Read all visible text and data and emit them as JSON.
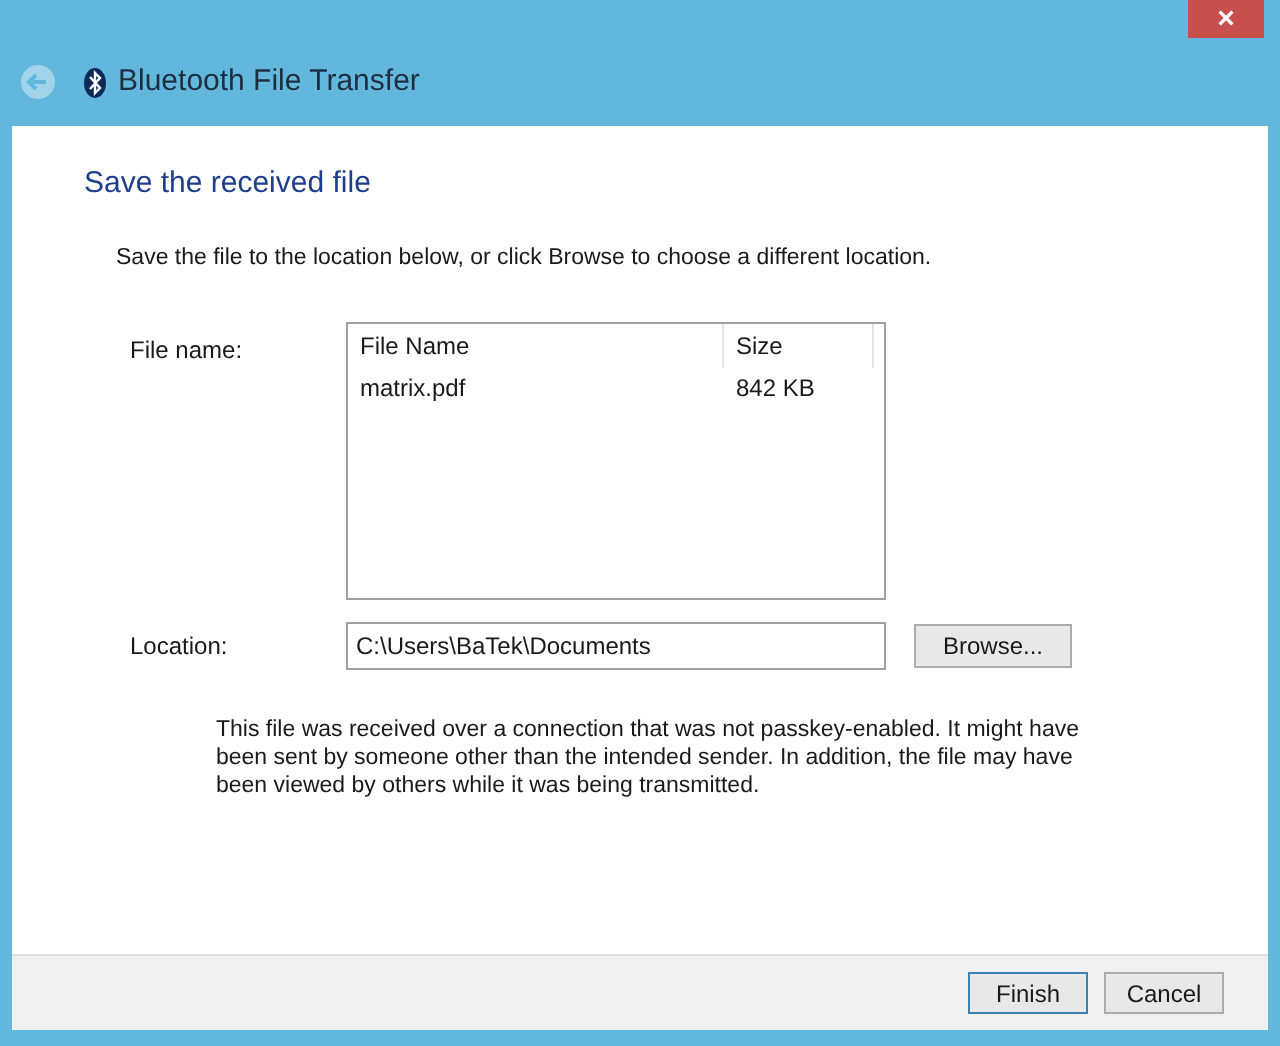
{
  "window": {
    "title": "Bluetooth File Transfer",
    "close": "×",
    "back_disabled": true
  },
  "heading": "Save the received file",
  "instruction": "Save the file to the location below, or click Browse to choose a different location.",
  "file_label": "File name:",
  "file_list": {
    "columns": [
      "File Name",
      "Size"
    ],
    "rows": [
      [
        "matrix.pdf",
        "842 KB"
      ]
    ]
  },
  "location_label": "Location:",
  "location_value": "C:\\Users\\BaTek\\Documents",
  "browse_button": "Browse...",
  "warning": "This file was received over a connection that was not passkey-enabled. It might have been sent by someone other than the intended sender.  In addition, the file may have been viewed by others while it was being transmitted.",
  "buttons": [
    {
      "label": "Finish",
      "default": true
    },
    {
      "label": "Cancel",
      "default": false
    }
  ]
}
